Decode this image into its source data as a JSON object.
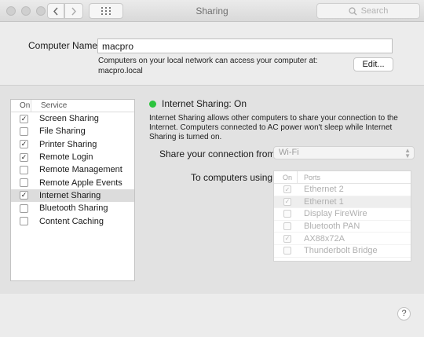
{
  "window": {
    "title": "Sharing"
  },
  "toolbar": {
    "search_placeholder": "Search",
    "back_icon": "chevron-left",
    "forward_icon": "chevron-right",
    "grid_icon": "grid-dots"
  },
  "computer": {
    "label": "Computer Name:",
    "name": "macpro",
    "note_line1": "Computers on your local network can access your computer at:",
    "note_line2": "macpro.local",
    "edit_label": "Edit..."
  },
  "services": {
    "header_on": "On",
    "header_service": "Service",
    "items": [
      {
        "name": "Screen Sharing",
        "checked": true
      },
      {
        "name": "File Sharing",
        "checked": false
      },
      {
        "name": "Printer Sharing",
        "checked": true
      },
      {
        "name": "Remote Login",
        "checked": true
      },
      {
        "name": "Remote Management",
        "checked": false
      },
      {
        "name": "Remote Apple Events",
        "checked": false
      },
      {
        "name": "Internet Sharing",
        "checked": true,
        "selected": true
      },
      {
        "name": "Bluetooth Sharing",
        "checked": false
      },
      {
        "name": "Content Caching",
        "checked": false
      }
    ]
  },
  "detail": {
    "status": "Internet Sharing: On",
    "status_color": "#2cc43e",
    "description": "Internet Sharing allows other computers to share your connection to the Internet. Computers connected to AC power won't sleep while Internet Sharing is turned on.",
    "share_from_label": "Share your connection from:",
    "share_from_value": "Wi-Fi",
    "to_label": "To computers using:",
    "ports_header_on": "On",
    "ports_header_name": "Ports",
    "ports": [
      {
        "name": "Ethernet 2",
        "checked": true
      },
      {
        "name": "Ethernet 1",
        "checked": true,
        "selected": true
      },
      {
        "name": "Display FireWire",
        "checked": false
      },
      {
        "name": "Bluetooth PAN",
        "checked": false
      },
      {
        "name": "AX88x72A",
        "checked": true
      },
      {
        "name": "Thunderbolt Bridge",
        "checked": false
      }
    ]
  },
  "help_label": "?"
}
